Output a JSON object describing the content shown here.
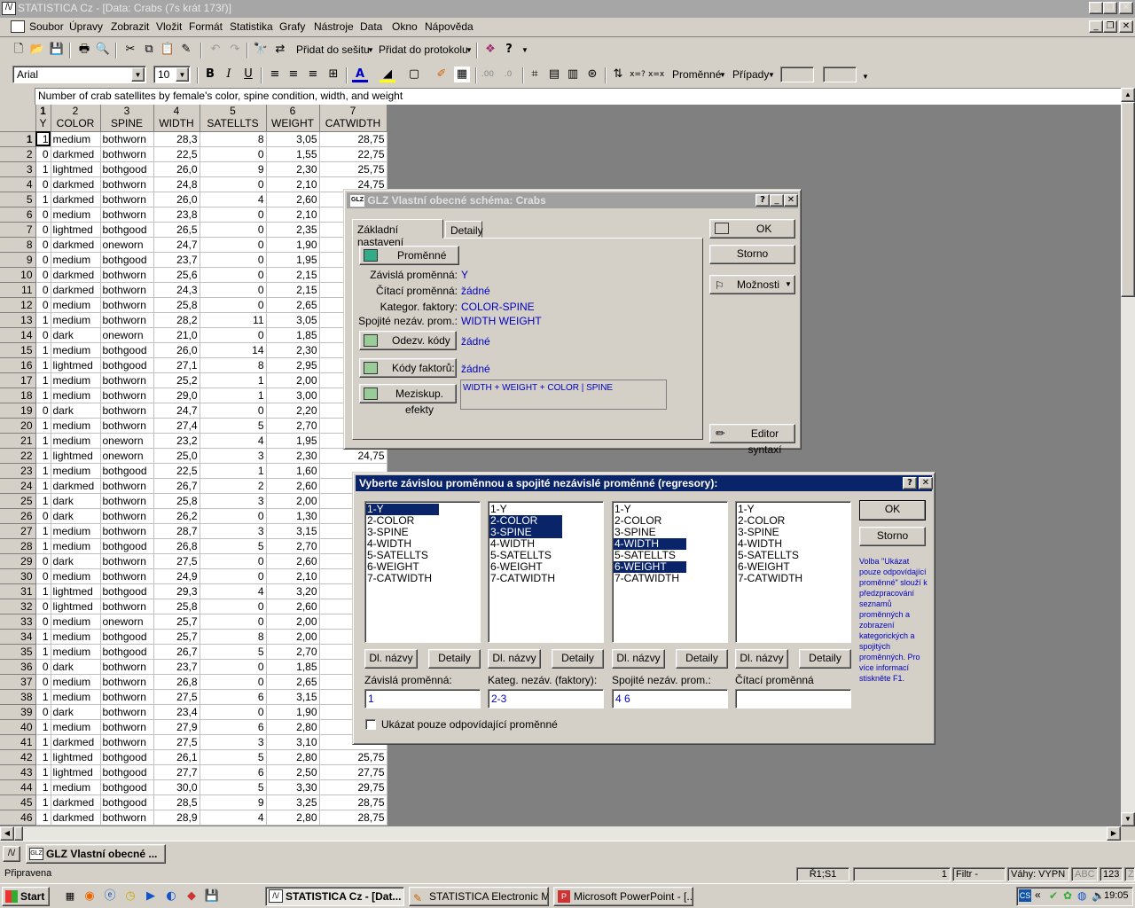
{
  "window": {
    "title": "STATISTICA Cz - [Data: Crabs (7s krát 173ř)]"
  },
  "menu": [
    "Soubor",
    "Úpravy",
    "Zobrazit",
    "Vložit",
    "Formát",
    "Statistika",
    "Grafy",
    "Nástroje",
    "Data",
    "Okno",
    "Nápověda"
  ],
  "toolbar1": {
    "add_workbook": "Přidat do sešitu",
    "add_log": "Přidat do protokolu"
  },
  "toolbar2": {
    "font": "Arial",
    "size": "10",
    "bold": "B",
    "italic": "I",
    "underline": "U",
    "variables": "Proměnné",
    "cases": "Případy"
  },
  "sheet": {
    "notes": "Number of crab satellites by female's color, spine condition, width, and weight",
    "headers": [
      {
        "num": "1",
        "name": "Y"
      },
      {
        "num": "2",
        "name": "COLOR"
      },
      {
        "num": "3",
        "name": "SPINE"
      },
      {
        "num": "4",
        "name": "WIDTH"
      },
      {
        "num": "5",
        "name": "SATELLTS"
      },
      {
        "num": "6",
        "name": "WEIGHT"
      },
      {
        "num": "7",
        "name": "CATWIDTH"
      }
    ],
    "rows": [
      [
        "1",
        "1",
        "medium",
        "bothworn",
        "28,3",
        "8",
        "3,05",
        "28,75"
      ],
      [
        "2",
        "0",
        "darkmed",
        "bothworn",
        "22,5",
        "0",
        "1,55",
        "22,75"
      ],
      [
        "3",
        "1",
        "lightmed",
        "bothgood",
        "26,0",
        "9",
        "2,30",
        "25,75"
      ],
      [
        "4",
        "0",
        "darkmed",
        "bothworn",
        "24,8",
        "0",
        "2,10",
        "24,75"
      ],
      [
        "5",
        "1",
        "darkmed",
        "bothworn",
        "26,0",
        "4",
        "2,60",
        ""
      ],
      [
        "6",
        "0",
        "medium",
        "bothworn",
        "23,8",
        "0",
        "2,10",
        ""
      ],
      [
        "7",
        "0",
        "lightmed",
        "bothgood",
        "26,5",
        "0",
        "2,35",
        ""
      ],
      [
        "8",
        "0",
        "darkmed",
        "oneworn",
        "24,7",
        "0",
        "1,90",
        ""
      ],
      [
        "9",
        "0",
        "medium",
        "bothgood",
        "23,7",
        "0",
        "1,95",
        ""
      ],
      [
        "10",
        "0",
        "darkmed",
        "bothworn",
        "25,6",
        "0",
        "2,15",
        ""
      ],
      [
        "11",
        "0",
        "darkmed",
        "bothworn",
        "24,3",
        "0",
        "2,15",
        ""
      ],
      [
        "12",
        "0",
        "medium",
        "bothworn",
        "25,8",
        "0",
        "2,65",
        ""
      ],
      [
        "13",
        "1",
        "medium",
        "bothworn",
        "28,2",
        "11",
        "3,05",
        ""
      ],
      [
        "14",
        "0",
        "dark",
        "oneworn",
        "21,0",
        "0",
        "1,85",
        ""
      ],
      [
        "15",
        "1",
        "medium",
        "bothgood",
        "26,0",
        "14",
        "2,30",
        ""
      ],
      [
        "16",
        "1",
        "lightmed",
        "bothgood",
        "27,1",
        "8",
        "2,95",
        ""
      ],
      [
        "17",
        "1",
        "medium",
        "bothworn",
        "25,2",
        "1",
        "2,00",
        ""
      ],
      [
        "18",
        "1",
        "medium",
        "bothworn",
        "29,0",
        "1",
        "3,00",
        ""
      ],
      [
        "19",
        "0",
        "dark",
        "bothworn",
        "24,7",
        "0",
        "2,20",
        ""
      ],
      [
        "20",
        "1",
        "medium",
        "bothworn",
        "27,4",
        "5",
        "2,70",
        ""
      ],
      [
        "21",
        "1",
        "medium",
        "oneworn",
        "23,2",
        "4",
        "1,95",
        ""
      ],
      [
        "22",
        "1",
        "lightmed",
        "oneworn",
        "25,0",
        "3",
        "2,30",
        "24,75"
      ],
      [
        "23",
        "1",
        "medium",
        "bothgood",
        "22,5",
        "1",
        "1,60",
        ""
      ],
      [
        "24",
        "1",
        "darkmed",
        "bothworn",
        "26,7",
        "2",
        "2,60",
        ""
      ],
      [
        "25",
        "1",
        "dark",
        "bothworn",
        "25,8",
        "3",
        "2,00",
        ""
      ],
      [
        "26",
        "0",
        "dark",
        "bothworn",
        "26,2",
        "0",
        "1,30",
        ""
      ],
      [
        "27",
        "1",
        "medium",
        "bothworn",
        "28,7",
        "3",
        "3,15",
        ""
      ],
      [
        "28",
        "1",
        "medium",
        "bothgood",
        "26,8",
        "5",
        "2,70",
        ""
      ],
      [
        "29",
        "0",
        "dark",
        "bothworn",
        "27,5",
        "0",
        "2,60",
        ""
      ],
      [
        "30",
        "0",
        "medium",
        "bothworn",
        "24,9",
        "0",
        "2,10",
        ""
      ],
      [
        "31",
        "1",
        "lightmed",
        "bothgood",
        "29,3",
        "4",
        "3,20",
        ""
      ],
      [
        "32",
        "0",
        "lightmed",
        "bothworn",
        "25,8",
        "0",
        "2,60",
        ""
      ],
      [
        "33",
        "0",
        "medium",
        "oneworn",
        "25,7",
        "0",
        "2,00",
        ""
      ],
      [
        "34",
        "1",
        "medium",
        "bothgood",
        "25,7",
        "8",
        "2,00",
        ""
      ],
      [
        "35",
        "1",
        "medium",
        "bothgood",
        "26,7",
        "5",
        "2,70",
        ""
      ],
      [
        "36",
        "0",
        "dark",
        "bothworn",
        "23,7",
        "0",
        "1,85",
        ""
      ],
      [
        "37",
        "0",
        "medium",
        "bothworn",
        "26,8",
        "0",
        "2,65",
        ""
      ],
      [
        "38",
        "1",
        "medium",
        "bothworn",
        "27,5",
        "6",
        "3,15",
        ""
      ],
      [
        "39",
        "0",
        "dark",
        "bothworn",
        "23,4",
        "0",
        "1,90",
        ""
      ],
      [
        "40",
        "1",
        "medium",
        "bothworn",
        "27,9",
        "6",
        "2,80",
        ""
      ],
      [
        "41",
        "1",
        "darkmed",
        "bothworn",
        "27,5",
        "3",
        "3,10",
        ""
      ],
      [
        "42",
        "1",
        "lightmed",
        "bothgood",
        "26,1",
        "5",
        "2,80",
        "25,75"
      ],
      [
        "43",
        "1",
        "lightmed",
        "bothgood",
        "27,7",
        "6",
        "2,50",
        "27,75"
      ],
      [
        "44",
        "1",
        "medium",
        "bothgood",
        "30,0",
        "5",
        "3,30",
        "29,75"
      ],
      [
        "45",
        "1",
        "darkmed",
        "bothgood",
        "28,5",
        "9",
        "3,25",
        "28,75"
      ],
      [
        "46",
        "1",
        "darkmed",
        "bothworn",
        "28,9",
        "4",
        "2,80",
        "28,75"
      ]
    ]
  },
  "glz": {
    "title": "GLZ Vlastní obecné schéma: Crabs",
    "tabs": [
      "Základní nastavení",
      "Detaily"
    ],
    "variables_btn": "Proměnné",
    "labels": {
      "dependent": "Závislá proměnná:",
      "count": "Čítací proměnná:",
      "categorical": "Kategor. faktory:",
      "continuous": "Spojité nezáv. prom.:"
    },
    "values": {
      "dependent": "Y",
      "count": "žádné",
      "categorical": "COLOR-SPINE",
      "continuous": "WIDTH WEIGHT"
    },
    "response_codes_btn": "Odezv. kódy",
    "response_codes_val": "žádné",
    "factor_codes_btn": "Kódy faktorů:",
    "factor_codes_val": "žádné",
    "effects_btn": "Meziskup. efekty",
    "effects_val": "WIDTH + WEIGHT + COLOR | SPINE",
    "ok": "OK",
    "cancel": "Storno",
    "options": "Možnosti",
    "syntax": "Editor syntaxí"
  },
  "varsel": {
    "title": "Vyberte závislou proměnnou a spojité nezávislé proměnné (regresory):",
    "items": [
      "1-Y",
      "2-COLOR",
      "3-SPINE",
      "4-WIDTH",
      "5-SATELLTS",
      "6-WEIGHT",
      "7-CATWIDTH"
    ],
    "names_btn": "Dl. názvy",
    "details_btn": "Detaily",
    "col_labels": [
      "Závislá proměnná:",
      "Kateg. nezáv. (faktory):",
      "Spojité nezáv. prom.:",
      "Čítací proměnná"
    ],
    "fields": [
      "1",
      "2-3",
      "4 6",
      ""
    ],
    "ok": "OK",
    "cancel": "Storno",
    "help": "Volba \"Ukázat pouze odpovídající proměnné\" slouží k předzpracování seznamů proměnných a zobrazení kategorických a spojitých proměnných. Pro více informací stiskněte F1.",
    "checkbox": "Ukázat pouze odpovídající proměnné"
  },
  "mdi_task": "GLZ Vlastní obecné ...",
  "status": {
    "ready": "Připravena",
    "cell": "Ř1;S1",
    "filter_num": "1",
    "filter": "Filtr -",
    "weights": "Váhy: VYPN",
    "abc": "ABC",
    "n123": "123",
    "zaz": "ZÁZN"
  },
  "taskbar": {
    "start": "Start",
    "tasks": [
      "STATISTICA Cz - [Dat...",
      "STATISTICA Electronic M...",
      "Microsoft PowerPoint - [..."
    ],
    "clock": "19:05"
  }
}
